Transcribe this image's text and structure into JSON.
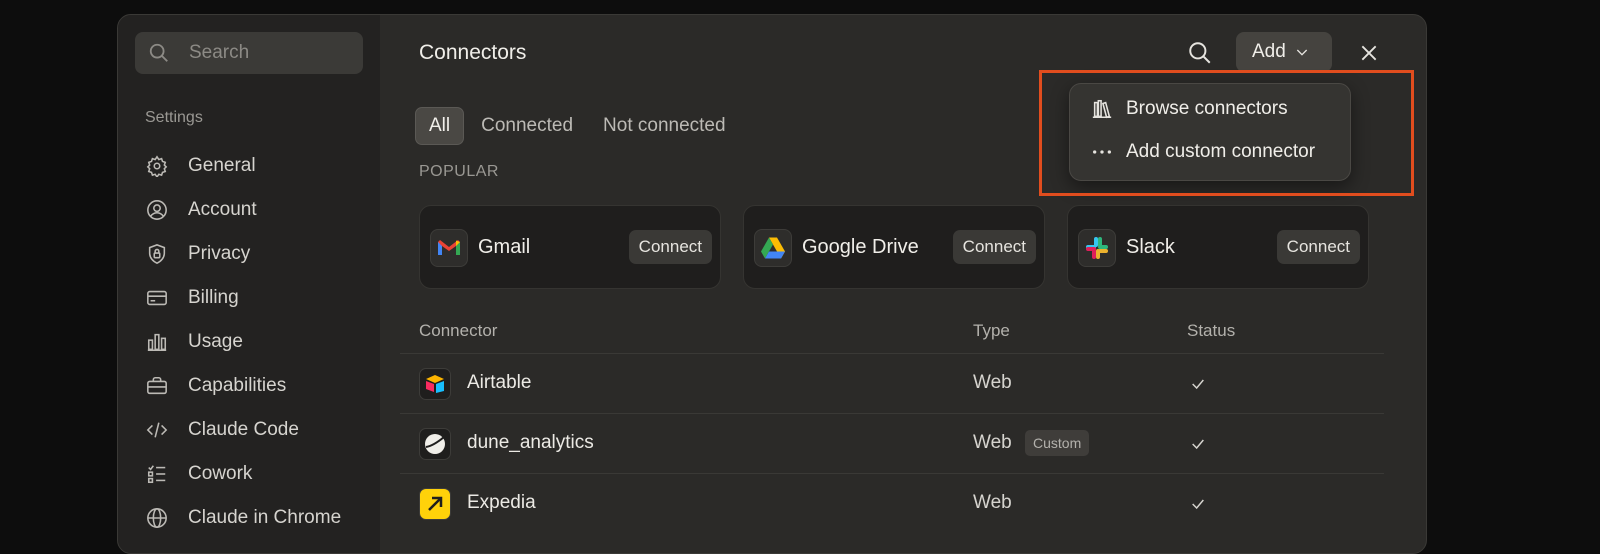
{
  "sidebar": {
    "search_placeholder": "Search",
    "section_label": "Settings",
    "items": [
      {
        "label": "General",
        "icon": "gear-icon"
      },
      {
        "label": "Account",
        "icon": "user-circle-icon"
      },
      {
        "label": "Privacy",
        "icon": "shield-lock-icon"
      },
      {
        "label": "Billing",
        "icon": "credit-card-icon"
      },
      {
        "label": "Usage",
        "icon": "bar-chart-icon"
      },
      {
        "label": "Capabilities",
        "icon": "briefcase-icon"
      },
      {
        "label": "Claude Code",
        "icon": "code-icon"
      },
      {
        "label": "Cowork",
        "icon": "checklist-icon"
      },
      {
        "label": "Claude in Chrome",
        "icon": "globe-icon"
      }
    ]
  },
  "header": {
    "title": "Connectors",
    "add_label": "Add"
  },
  "tabs": [
    {
      "label": "All",
      "active": true
    },
    {
      "label": "Connected",
      "active": false
    },
    {
      "label": "Not connected",
      "active": false
    }
  ],
  "popular": {
    "label": "POPULAR",
    "cards": [
      {
        "name": "Gmail",
        "button": "Connect",
        "icon": "gmail-icon"
      },
      {
        "name": "Google Drive",
        "button": "Connect",
        "icon": "google-drive-icon"
      },
      {
        "name": "Slack",
        "button": "Connect",
        "icon": "slack-icon"
      }
    ]
  },
  "table": {
    "headers": {
      "connector": "Connector",
      "type": "Type",
      "status": "Status"
    },
    "rows": [
      {
        "name": "Airtable",
        "type": "Web",
        "badge": "",
        "icon": "airtable-icon",
        "status": "check-icon"
      },
      {
        "name": "dune_analytics",
        "type": "Web",
        "badge": "Custom",
        "icon": "dune-analytics-icon",
        "status": "check-icon"
      },
      {
        "name": "Expedia",
        "type": "Web",
        "badge": "",
        "icon": "expedia-icon",
        "status": "check-icon"
      }
    ]
  },
  "dropdown": {
    "items": [
      {
        "label": "Browse connectors",
        "icon": "library-icon"
      },
      {
        "label": "Add custom connector",
        "icon": "more-horizontal-icon"
      }
    ]
  },
  "colors": {
    "highlight": "#e14d1e",
    "accent_bg": "#2b2a28"
  }
}
